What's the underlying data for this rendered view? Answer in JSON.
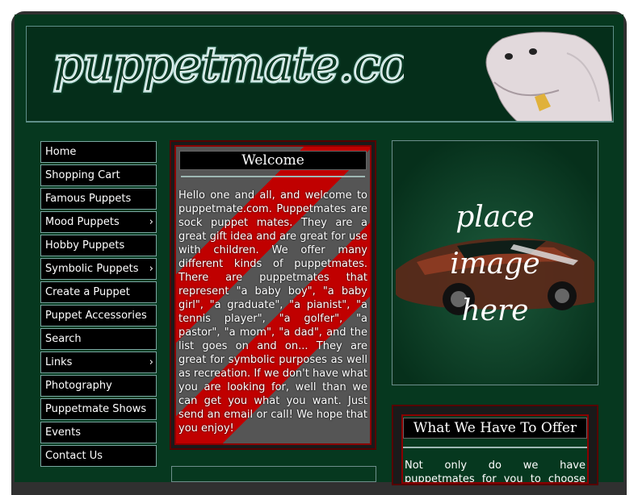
{
  "header": {
    "logo_text": "puppetmate.com"
  },
  "nav": {
    "items": [
      {
        "label": "Home",
        "has_submenu": false
      },
      {
        "label": "Shopping Cart",
        "has_submenu": false
      },
      {
        "label": "Famous Puppets",
        "has_submenu": false
      },
      {
        "label": "Mood Puppets",
        "has_submenu": true
      },
      {
        "label": "Hobby Puppets",
        "has_submenu": false
      },
      {
        "label": "Symbolic Puppets",
        "has_submenu": true
      },
      {
        "label": "Create a Puppet",
        "has_submenu": false
      },
      {
        "label": "Puppet Accessories",
        "has_submenu": false
      },
      {
        "label": "Search",
        "has_submenu": false
      },
      {
        "label": "Links",
        "has_submenu": true
      },
      {
        "label": "Photography",
        "has_submenu": false
      },
      {
        "label": "Puppetmate Shows",
        "has_submenu": false
      },
      {
        "label": "Events",
        "has_submenu": false
      },
      {
        "label": "Contact Us",
        "has_submenu": false
      }
    ],
    "submenu_glyph": "›"
  },
  "welcome": {
    "title": "Welcome",
    "body": "Hello one and all, and welcome to puppetmate.com. Puppetmates are sock puppet mates. They are a great gift idea and are great for use with children. We offer many different kinds of puppetmates. There are puppetmates that represent \"a baby boy\", \"a baby girl\", \"a graduate\", \"a pianist\", \"a tennis player\", \"a golfer\", \"a pastor\", \"a mom\", \"a dad\", and the list goes on and on... They are great for symbolic purposes as well as recreation. If we don't have what you are looking for, well than we can get you what you want. Just send an email or call! We hope that you enjoy!"
  },
  "placeholder": {
    "line1": "place",
    "line2": "image",
    "line3": "here"
  },
  "offer": {
    "title": "What We Have To Offer",
    "body": "Not only do we have puppetmates for you to choose and purchase"
  },
  "colors": {
    "page_bg": "#06381f",
    "frame": "#303030",
    "nav_bg": "#000000",
    "nav_border": "#7aa7a1",
    "accent_red": "#c00000",
    "text": "#ffffff"
  }
}
